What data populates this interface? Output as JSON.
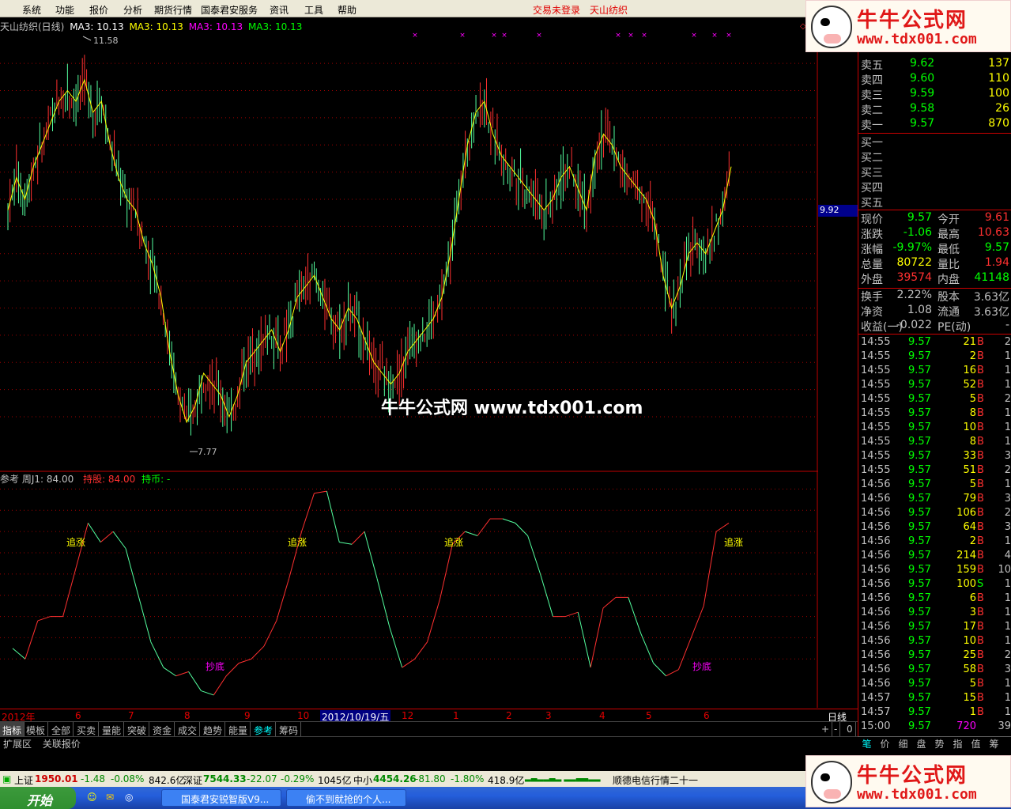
{
  "menu": {
    "items": [
      "系统",
      "功能",
      "报价",
      "分析",
      "期货行情",
      "国泰君安服务",
      "资讯",
      "工具",
      "帮助"
    ],
    "status": "交易未登录",
    "stock": "天山纺织"
  },
  "chart_header": {
    "name": "天山纺织(日线)",
    "ma1": "MA3: 10.13",
    "ma2": "MA3: 10.13",
    "ma3": "MA3: 10.13",
    "ma4": "MA3: 10.13"
  },
  "price_labels": {
    "high": "11.58",
    "low": "7.77",
    "current_marker": "9.92"
  },
  "indicator_header": {
    "name": "参考",
    "j1": "周J1: 84.00",
    "hold": "持股: 84.00",
    "cash": "持币: -"
  },
  "signals": {
    "chase": "追涨",
    "bottom": "抄底"
  },
  "date_axis": [
    "2012年",
    "6",
    "7",
    "8",
    "9",
    "10",
    "2012/10/19/五",
    "12",
    "1",
    "2",
    "3",
    "4",
    "5",
    "6"
  ],
  "date_axis_right": "日线",
  "bottom_tabs": [
    "指标",
    "模板",
    "全部",
    "买卖",
    "量能",
    "突破",
    "资金",
    "成交",
    "趋势",
    "能量",
    "参考",
    "筹码"
  ],
  "bottom_tabs_active": "参考",
  "extras": [
    "扩展区",
    "关联报价"
  ],
  "nav_buttons": [
    "+",
    "-",
    "0"
  ],
  "order_book": {
    "sells": [
      {
        "label": "卖五",
        "price": "9.62",
        "vol": "137"
      },
      {
        "label": "卖四",
        "price": "9.60",
        "vol": "110"
      },
      {
        "label": "卖三",
        "price": "9.59",
        "vol": "100"
      },
      {
        "label": "卖二",
        "price": "9.58",
        "vol": "26"
      },
      {
        "label": "卖一",
        "price": "9.57",
        "vol": "870"
      }
    ],
    "buys": [
      "买一",
      "买二",
      "买三",
      "买四",
      "买五"
    ]
  },
  "quote": [
    {
      "l1": "现价",
      "v1": "9.57",
      "l2": "今开",
      "v2": "9.61"
    },
    {
      "l1": "涨跌",
      "v1": "-1.06",
      "l2": "最高",
      "v2": "10.63"
    },
    {
      "l1": "涨幅",
      "v1": "-9.97%",
      "l2": "最低",
      "v2": "9.57"
    },
    {
      "l1": "总量",
      "v1": "80722",
      "l2": "量比",
      "v2": "1.94"
    },
    {
      "l1": "外盘",
      "v1": "39574",
      "l2": "内盘",
      "v2": "41148"
    },
    {
      "l1": "换手",
      "v1": "2.22%",
      "l2": "股本",
      "v2": "3.63亿"
    },
    {
      "l1": "净资",
      "v1": "1.08",
      "l2": "流通",
      "v2": "3.63亿"
    },
    {
      "l1": "收益(一)",
      "v1": "-0.022",
      "l2": "PE(动)",
      "v2": "-"
    }
  ],
  "trades": [
    [
      "14:55",
      "9.57",
      "21",
      "B",
      "2"
    ],
    [
      "14:55",
      "9.57",
      "2",
      "B",
      "1"
    ],
    [
      "14:55",
      "9.57",
      "16",
      "B",
      "1"
    ],
    [
      "14:55",
      "9.57",
      "52",
      "B",
      "1"
    ],
    [
      "14:55",
      "9.57",
      "5",
      "B",
      "2"
    ],
    [
      "14:55",
      "9.57",
      "8",
      "B",
      "1"
    ],
    [
      "14:55",
      "9.57",
      "10",
      "B",
      "1"
    ],
    [
      "14:55",
      "9.57",
      "8",
      "B",
      "1"
    ],
    [
      "14:55",
      "9.57",
      "33",
      "B",
      "3"
    ],
    [
      "14:55",
      "9.57",
      "51",
      "B",
      "2"
    ],
    [
      "14:56",
      "9.57",
      "5",
      "B",
      "1"
    ],
    [
      "14:56",
      "9.57",
      "79",
      "B",
      "3"
    ],
    [
      "14:56",
      "9.57",
      "106",
      "B",
      "2"
    ],
    [
      "14:56",
      "9.57",
      "64",
      "B",
      "3"
    ],
    [
      "14:56",
      "9.57",
      "2",
      "B",
      "1"
    ],
    [
      "14:56",
      "9.57",
      "214",
      "B",
      "4"
    ],
    [
      "14:56",
      "9.57",
      "159",
      "B",
      "10"
    ],
    [
      "14:56",
      "9.57",
      "100",
      "S",
      "1"
    ],
    [
      "14:56",
      "9.57",
      "6",
      "B",
      "1"
    ],
    [
      "14:56",
      "9.57",
      "3",
      "B",
      "1"
    ],
    [
      "14:56",
      "9.57",
      "17",
      "B",
      "1"
    ],
    [
      "14:56",
      "9.57",
      "10",
      "B",
      "1"
    ],
    [
      "14:56",
      "9.57",
      "25",
      "B",
      "2"
    ],
    [
      "14:56",
      "9.57",
      "58",
      "B",
      "3"
    ],
    [
      "14:56",
      "9.57",
      "5",
      "B",
      "1"
    ],
    [
      "14:57",
      "9.57",
      "15",
      "B",
      "1"
    ],
    [
      "14:57",
      "9.57",
      "1",
      "B",
      "1"
    ],
    [
      "15:00",
      "9.57",
      "720",
      "",
      "39"
    ]
  ],
  "right_tabs": [
    "笔",
    "价",
    "细",
    "盘",
    "势",
    "指",
    "值",
    "筹"
  ],
  "status_bar": {
    "sh_label": "上证",
    "sh_val": "1950.01",
    "sh_chg": "-1.48",
    "sh_pct": "-0.08%",
    "sh_amt": "842.6亿",
    "sz_label": "深证",
    "sz_val": "7544.33",
    "sz_chg": "-22.07",
    "sz_pct": "-0.29%",
    "sz_amt": "1045亿",
    "zx_label": "中小",
    "zx_val": "4454.26",
    "zx_chg": "-81.80",
    "zx_pct": "-1.80%",
    "zx_amt": "418.9亿",
    "news": "顺德电信行情二十一"
  },
  "taskbar": {
    "start": "开始",
    "task1": "国泰君安锐智版V9...",
    "task2": "偷不到就抢的个人..."
  },
  "watermark": {
    "brand": "牛牛公式网",
    "url": "www.tdx001.com",
    "center": "牛牛公式网 www.tdx001.com"
  },
  "colors": {
    "up": "#ff3030",
    "down": "#54ff9f",
    "ma": "#ffff00",
    "grid": "#c00000",
    "text_green": "#00ff00",
    "text_red": "#ff3030"
  },
  "chart_data": [
    {
      "type": "line",
      "title": "天山纺织(日线)",
      "y_ticks": [
        11.25,
        11.0,
        10.75,
        10.5,
        10.25,
        10.0,
        9.75,
        9.5,
        9.25,
        9.0,
        8.75,
        8.5,
        8.25,
        8.0
      ],
      "ylim": [
        7.6,
        11.6
      ],
      "series": [
        {
          "name": "MA3",
          "values": [
            9.9,
            10.2,
            10.0,
            10.3,
            10.5,
            10.7,
            10.9,
            11.0,
            10.9,
            11.1,
            10.8,
            10.9,
            10.5,
            10.2,
            10.0,
            9.9,
            9.6,
            9.4,
            9.1,
            8.6,
            8.2,
            7.95,
            8.1,
            8.4,
            8.3,
            8.2,
            8.0,
            8.2,
            8.5,
            8.6,
            8.7,
            8.8,
            8.6,
            8.8,
            9.1,
            9.2,
            9.3,
            9.1,
            8.9,
            8.8,
            9.0,
            8.9,
            8.7,
            8.5,
            8.4,
            8.3,
            8.4,
            8.6,
            8.7,
            8.8,
            8.9,
            9.1,
            9.5,
            10.0,
            10.5,
            10.8,
            10.9,
            10.6,
            10.4,
            10.3,
            10.2,
            10.1,
            10.0,
            9.9,
            10.0,
            10.2,
            10.3,
            10.1,
            9.9,
            10.4,
            10.6,
            10.5,
            10.3,
            10.2,
            10.1,
            10.0,
            9.8,
            9.3,
            9.0,
            9.2,
            9.5,
            9.6,
            9.5,
            9.7,
            9.9,
            10.3
          ]
        }
      ]
    },
    {
      "type": "line",
      "title": "参考",
      "y_ticks": [
        100.0,
        90.0,
        80.0,
        70.0,
        60.0,
        50.0,
        40.0,
        30.0,
        20.0
      ],
      "ylim": [
        0,
        105
      ],
      "series": [
        {
          "name": "周J1",
          "values": [
            25,
            20,
            38,
            40,
            40,
            62,
            84,
            75,
            80,
            72,
            50,
            28,
            16,
            12,
            14,
            5,
            3,
            12,
            18,
            20,
            26,
            38,
            58,
            80,
            98,
            99,
            75,
            74,
            80,
            58,
            35,
            16,
            20,
            28,
            48,
            74,
            80,
            78,
            86,
            86,
            84,
            78,
            60,
            40,
            40,
            42,
            16,
            44,
            49,
            49,
            32,
            18,
            12,
            15,
            30,
            45,
            80,
            84
          ]
        }
      ]
    }
  ]
}
